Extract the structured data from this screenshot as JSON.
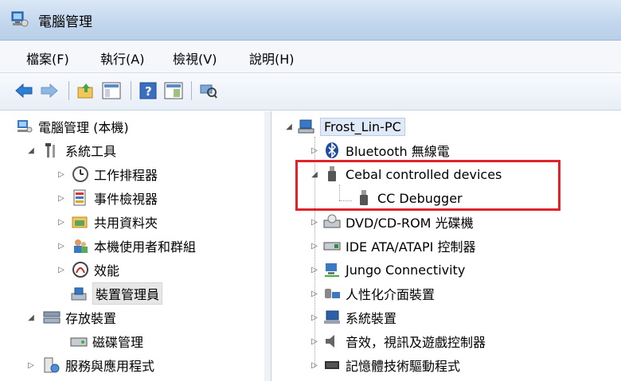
{
  "window": {
    "title": "電腦管理",
    "app_icon": "computer-management-icon"
  },
  "menu": [
    "檔案(F)",
    "執行(A)",
    "檢視(V)",
    "說明(H)"
  ],
  "toolbar": {
    "buttons": [
      "back-arrow-icon",
      "forward-arrow-icon",
      "up-folder-icon",
      "show-hide-tree-icon",
      "help-icon",
      "properties-icon",
      "scan-hardware-icon"
    ]
  },
  "left_tree": {
    "root": "電腦管理 (本機)",
    "system_tools": "系統工具",
    "task_scheduler": "工作排程器",
    "event_viewer": "事件檢視器",
    "shared_folders": "共用資料夾",
    "local_users": "本機使用者和群組",
    "performance": "效能",
    "device_manager": "裝置管理員",
    "storage": "存放裝置",
    "disk_management": "磁碟管理",
    "services_apps": "服務與應用程式"
  },
  "right_tree": {
    "host": "Frost_Lin-PC",
    "bluetooth": "Bluetooth 無線電",
    "cebal": "Cebal controlled devices",
    "cc_debugger": "CC Debugger",
    "dvd": "DVD/CD-ROM 光碟機",
    "ide": "IDE ATA/ATAPI 控制器",
    "jungo": "Jungo Connectivity",
    "hid": "人性化介面裝置",
    "system_devices": "系統裝置",
    "sound": "音效，視訊及遊戲控制器",
    "memory": "記憶體技術驅動程式"
  },
  "colors": {
    "highlight": "#e0232b",
    "titlebar": "#c3d7ee"
  }
}
